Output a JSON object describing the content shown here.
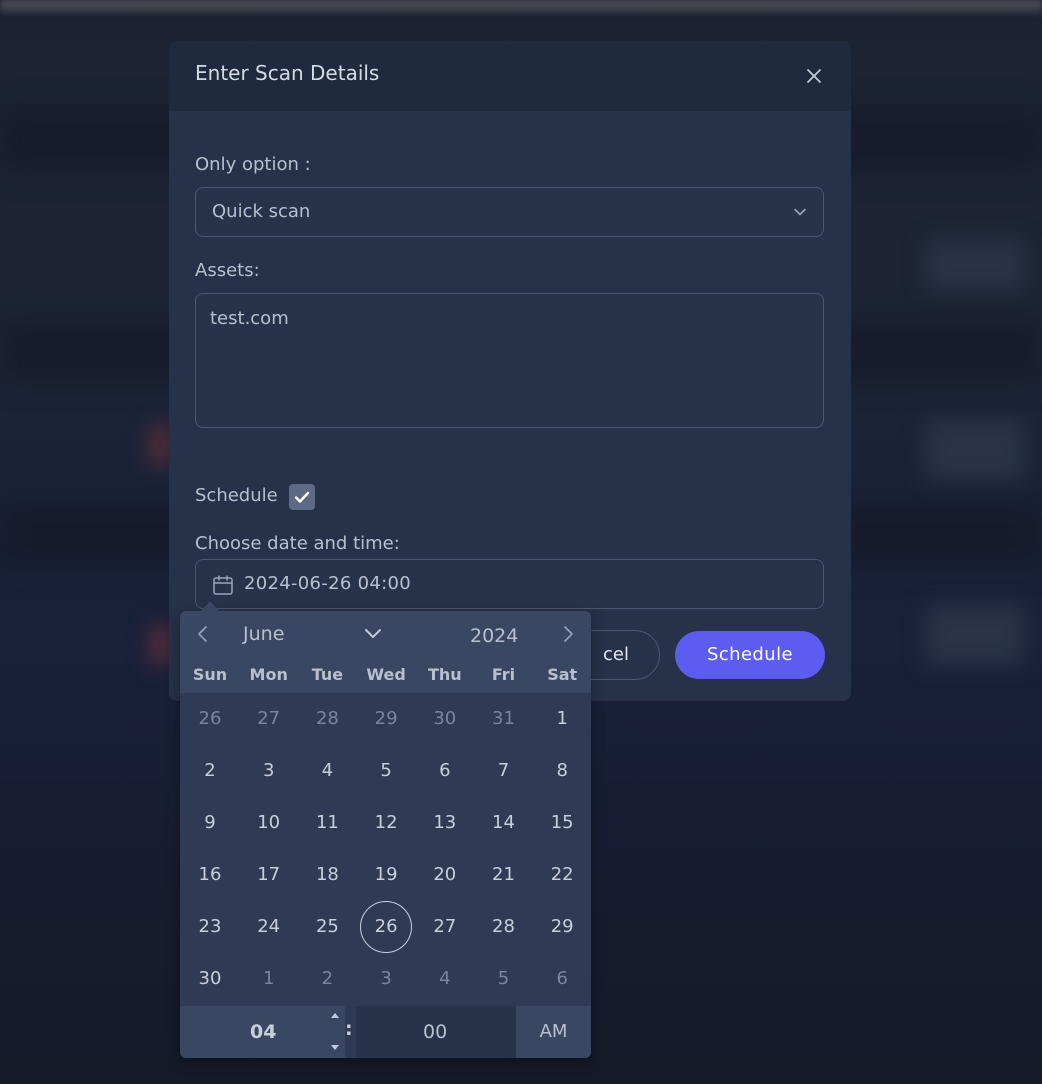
{
  "modal": {
    "title": "Enter Scan Details",
    "option_label": "Only option :",
    "option_value": "Quick scan",
    "assets_label": "Assets:",
    "assets_value": "test.com",
    "schedule_label": "Schedule",
    "schedule_checked": true,
    "datetime_label": "Choose date and time:",
    "datetime_value": "2024-06-26 04:00",
    "cancel_label": "Cancel",
    "cancel_visible_text": "cel",
    "schedule_button": "Schedule"
  },
  "datepicker": {
    "month": "June",
    "year": "2024",
    "weekdays": [
      "Sun",
      "Mon",
      "Tue",
      "Wed",
      "Thu",
      "Fri",
      "Sat"
    ],
    "weeks": [
      [
        "26",
        "27",
        "28",
        "29",
        "30",
        "31",
        "1"
      ],
      [
        "2",
        "3",
        "4",
        "5",
        "6",
        "7",
        "8"
      ],
      [
        "9",
        "10",
        "11",
        "12",
        "13",
        "14",
        "15"
      ],
      [
        "16",
        "17",
        "18",
        "19",
        "20",
        "21",
        "22"
      ],
      [
        "23",
        "24",
        "25",
        "26",
        "27",
        "28",
        "29"
      ],
      [
        "30",
        "1",
        "2",
        "3",
        "4",
        "5",
        "6"
      ]
    ],
    "muted_days": [
      [
        0,
        0
      ],
      [
        0,
        1
      ],
      [
        0,
        2
      ],
      [
        0,
        3
      ],
      [
        0,
        4
      ],
      [
        0,
        5
      ],
      [
        5,
        1
      ],
      [
        5,
        2
      ],
      [
        5,
        3
      ],
      [
        5,
        4
      ],
      [
        5,
        5
      ],
      [
        5,
        6
      ]
    ],
    "selected_day": [
      4,
      3
    ],
    "hour": "04",
    "minute": "00",
    "ampm": "AM"
  },
  "colors": {
    "accent": "#5c5cf0",
    "modal_bg": "#26324a",
    "picker_bg": "#2f3b55"
  }
}
